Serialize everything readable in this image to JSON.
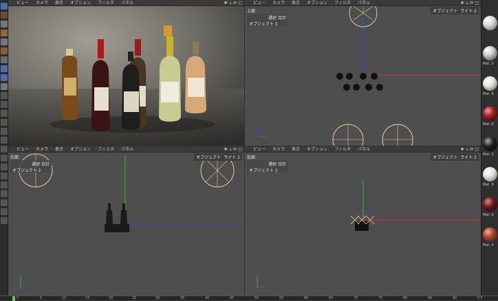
{
  "menu": [
    "ビュー",
    "カメラ",
    "表示",
    "オプション",
    "フィルタ",
    "パネル"
  ],
  "viewport_icons": "✥ ⇣ ⟳ ▢",
  "viewports": {
    "top": {
      "name": "上面",
      "hud_line1": "選択 合計",
      "hud_line2": "オブジェクト 1",
      "overlay_object": "オブジェクト",
      "overlay_light": "ライト 2"
    },
    "right": {
      "name": "右面",
      "hud_line1": "選択 合計",
      "hud_line2": "オブジェクト 1",
      "overlay_object": "オブジェクト",
      "overlay_light": "ライト 2"
    },
    "front": {
      "name": "前面",
      "hud_line1": "選択 合計",
      "hud_line2": "オブジェクト 1",
      "overlay_object": "オブジェクト",
      "overlay_light": "ライト 2"
    }
  },
  "materials": [
    {
      "label": "Mat. 5",
      "color": "#d9d9d9"
    },
    {
      "label": "Mat. 8",
      "color": "#e8e4dc"
    },
    {
      "label": "Mat. 6",
      "color": "#9a2020"
    },
    {
      "label": "Mat. 5",
      "color": "#222222"
    },
    {
      "label": "Mat. 9",
      "color": "#e6e2d8"
    },
    {
      "label": "Mat. 6",
      "color": "#6a1a1a"
    },
    {
      "label": "Mat. 4",
      "color": "#a8462e"
    }
  ],
  "timeline": {
    "ticks": [
      "0",
      "5",
      "10",
      "15",
      "20",
      "25",
      "30",
      "35",
      "40",
      "45",
      "50",
      "55",
      "60",
      "65",
      "70",
      "75",
      "80",
      "85",
      "90",
      "0 F"
    ],
    "current_frame": "0"
  },
  "colors": {
    "axis_x": "#e03030",
    "axis_y": "#30c030",
    "axis_z": "#3050e0",
    "light": "#e8d090"
  }
}
